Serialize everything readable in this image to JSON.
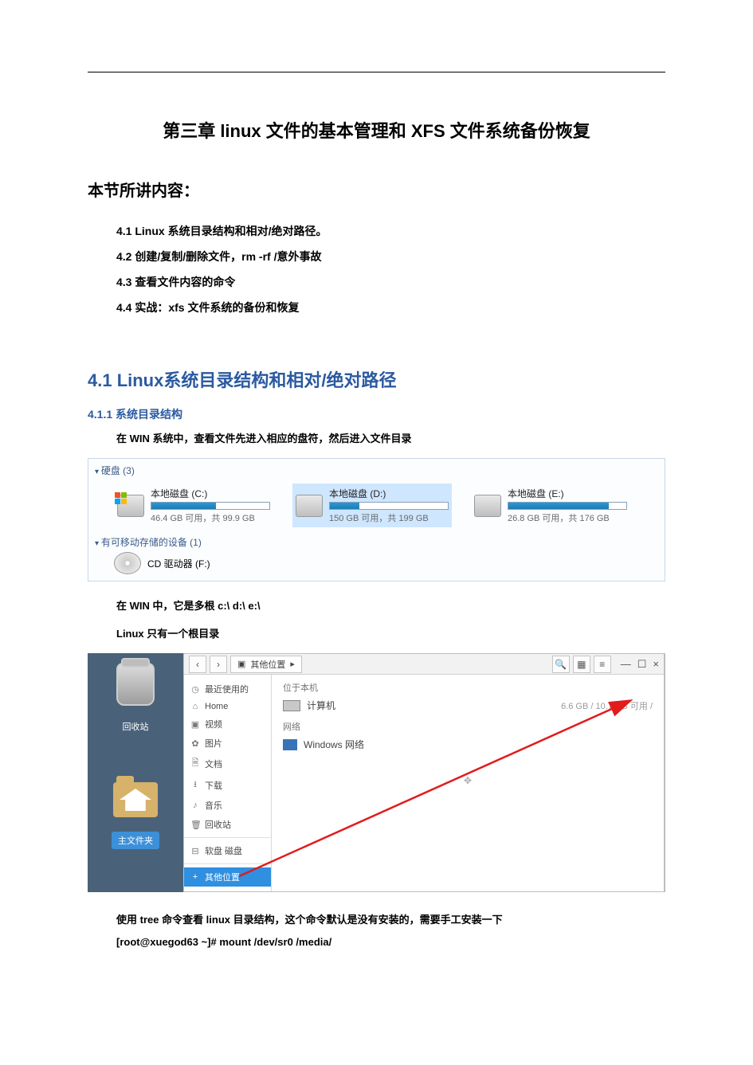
{
  "chapter_title": "第三章   linux 文件的基本管理和 XFS 文件系统备份恢复",
  "section_label": "本节所讲内容：",
  "toc": [
    "4.1   Linux 系统目录结构和相对/绝对路径。",
    "4.2   创建/复制/删除文件，rm  -rf /意外事故",
    "4.3   查看文件内容的命令",
    "4.4   实战：xfs 文件系统的备份和恢复"
  ],
  "h2_41": "4.1  Linux系统目录结构和相对/绝对路径",
  "h3_411": "4.1.1 系统目录结构",
  "p_win_intro": "在 WIN 系统中，查看文件先进入相应的盘符，然后进入文件目录",
  "win_drives": {
    "group_label": "硬盘 (3)",
    "drives": [
      {
        "label": "本地磁盘 (C:)",
        "free": "46.4 GB 可用，共 99.9 GB",
        "fill_pct": 55,
        "win_badge": true
      },
      {
        "label": "本地磁盘 (D:)",
        "free": "150 GB 可用，共 199 GB",
        "fill_pct": 25,
        "selected": true
      },
      {
        "label": "本地磁盘 (E:)",
        "free": "26.8 GB 可用，共 176 GB",
        "fill_pct": 85
      }
    ],
    "removable_label": "有可移动存储的设备 (1)",
    "cd_label": "CD 驱动器 (F:)"
  },
  "p_multi_root": "在 WIN 中，它是多根   c:\\       d:\\      e:\\",
  "p_linux_single": "Linux 只有一个根目录",
  "linux_fm": {
    "desktop_trash": "回收站",
    "desktop_folder": "主文件夹",
    "breadcrumb": "其他位置",
    "sidebar": [
      {
        "icon": "◷",
        "label": "最近使用的"
      },
      {
        "icon": "⌂",
        "label": "Home"
      },
      {
        "icon": "▣",
        "label": "视频"
      },
      {
        "icon": "✿",
        "label": "图片"
      },
      {
        "icon": "🗎",
        "label": "文档"
      },
      {
        "icon": "⭳",
        "label": "下载"
      },
      {
        "icon": "♪",
        "label": "音乐"
      },
      {
        "icon": "🗑",
        "label": "回收站"
      }
    ],
    "sidebar_device": {
      "icon": "⊟",
      "label": "软盘 磁盘"
    },
    "sidebar_other": {
      "icon": "+",
      "label": "其他位置"
    },
    "main_heading1": "位于本机",
    "entry_computer": "计算机",
    "entry_computer_cap": "6.6 GB / 10.7 GB 可用     /",
    "main_heading2": "网络",
    "entry_network": "Windows 网络"
  },
  "p_tree": "使用 tree 命令查看 linux 目录结构，这个命令默认是没有安装的，需要手工安装一下",
  "p_cmd": "[root@xuegod63 ~]# mount  /dev/sr0  /media/"
}
